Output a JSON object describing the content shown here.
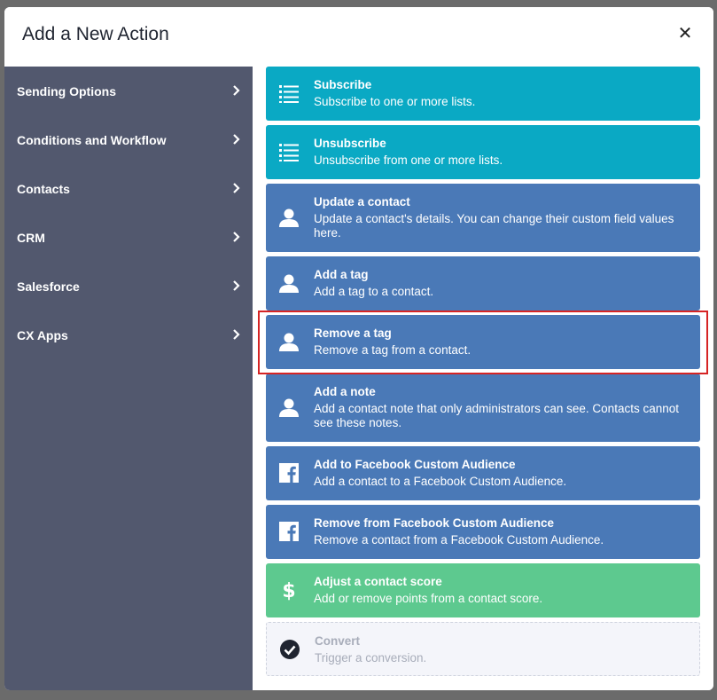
{
  "modal": {
    "title": "Add a New Action",
    "close_label": "✕"
  },
  "sidebar": {
    "items": [
      {
        "label": "Sending Options"
      },
      {
        "label": "Conditions and Workflow"
      },
      {
        "label": "Contacts"
      },
      {
        "label": "CRM"
      },
      {
        "label": "Salesforce"
      },
      {
        "label": "CX Apps"
      }
    ]
  },
  "actions": [
    {
      "title": "Subscribe",
      "desc": "Subscribe to one or more lists.",
      "icon": "list-icon",
      "color": "#0aa9c4"
    },
    {
      "title": "Unsubscribe",
      "desc": "Unsubscribe from one or more lists.",
      "icon": "list-icon",
      "color": "#0aa9c4"
    },
    {
      "title": "Update a contact",
      "desc": "Update a contact's details. You can change their custom field values here.",
      "icon": "user-icon",
      "color": "#4a79b7"
    },
    {
      "title": "Add a tag",
      "desc": "Add a tag to a contact.",
      "icon": "user-icon",
      "color": "#4a79b7"
    },
    {
      "title": "Remove a tag",
      "desc": "Remove a tag from a contact.",
      "icon": "user-icon",
      "color": "#4a79b7",
      "highlighted": true
    },
    {
      "title": "Add a note",
      "desc": "Add a contact note that only administrators can see. Contacts cannot see these notes.",
      "icon": "user-icon",
      "color": "#4a79b7"
    },
    {
      "title": "Add to Facebook Custom Audience",
      "desc": "Add a contact to a Facebook Custom Audience.",
      "icon": "facebook-icon",
      "color": "#4a79b7"
    },
    {
      "title": "Remove from Facebook Custom Audience",
      "desc": "Remove a contact from a Facebook Custom Audience.",
      "icon": "facebook-icon",
      "color": "#4a79b7"
    },
    {
      "title": "Adjust a contact score",
      "desc": "Add or remove points from a contact score.",
      "icon": "dollar-icon",
      "color": "#5dc98f"
    },
    {
      "title": "Convert",
      "desc": "Trigger a conversion.",
      "icon": "check-circle-icon",
      "color": "#f4f5fa",
      "disabled": true
    }
  ]
}
